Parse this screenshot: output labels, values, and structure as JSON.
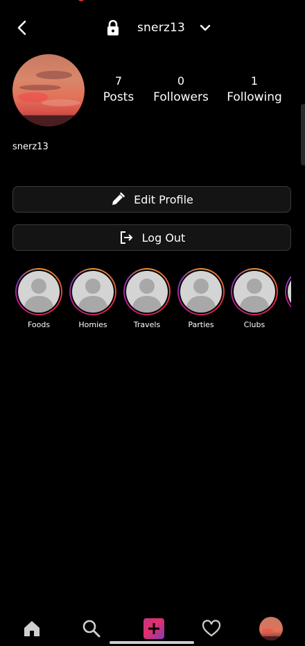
{
  "header": {
    "username": "snerz13",
    "icons": {
      "back": "back-arrow-icon",
      "lock": "lock-icon",
      "dropdown": "chevron-down-icon"
    }
  },
  "profile": {
    "display_name": "snerz13",
    "stats": [
      {
        "value": "7",
        "label": "Posts"
      },
      {
        "value": "0",
        "label": "Followers"
      },
      {
        "value": "1",
        "label": "Following"
      }
    ]
  },
  "buttons": {
    "edit_profile": "Edit Profile",
    "log_out": "Log Out"
  },
  "highlights": [
    {
      "label": "Foods"
    },
    {
      "label": "Homies"
    },
    {
      "label": "Travels"
    },
    {
      "label": "Parties"
    },
    {
      "label": "Clubs"
    },
    {
      "label": ""
    }
  ],
  "bottom_nav": {
    "items": [
      "home-icon",
      "search-icon",
      "add-post-icon",
      "heart-icon",
      "profile-avatar"
    ]
  },
  "colors": {
    "background": "#000000",
    "button_bg": "#141414",
    "button_border": "#3c3c3c",
    "story_ring_start": "#f09433",
    "story_ring_end": "#833ab4",
    "add_button": "#e1306c"
  }
}
